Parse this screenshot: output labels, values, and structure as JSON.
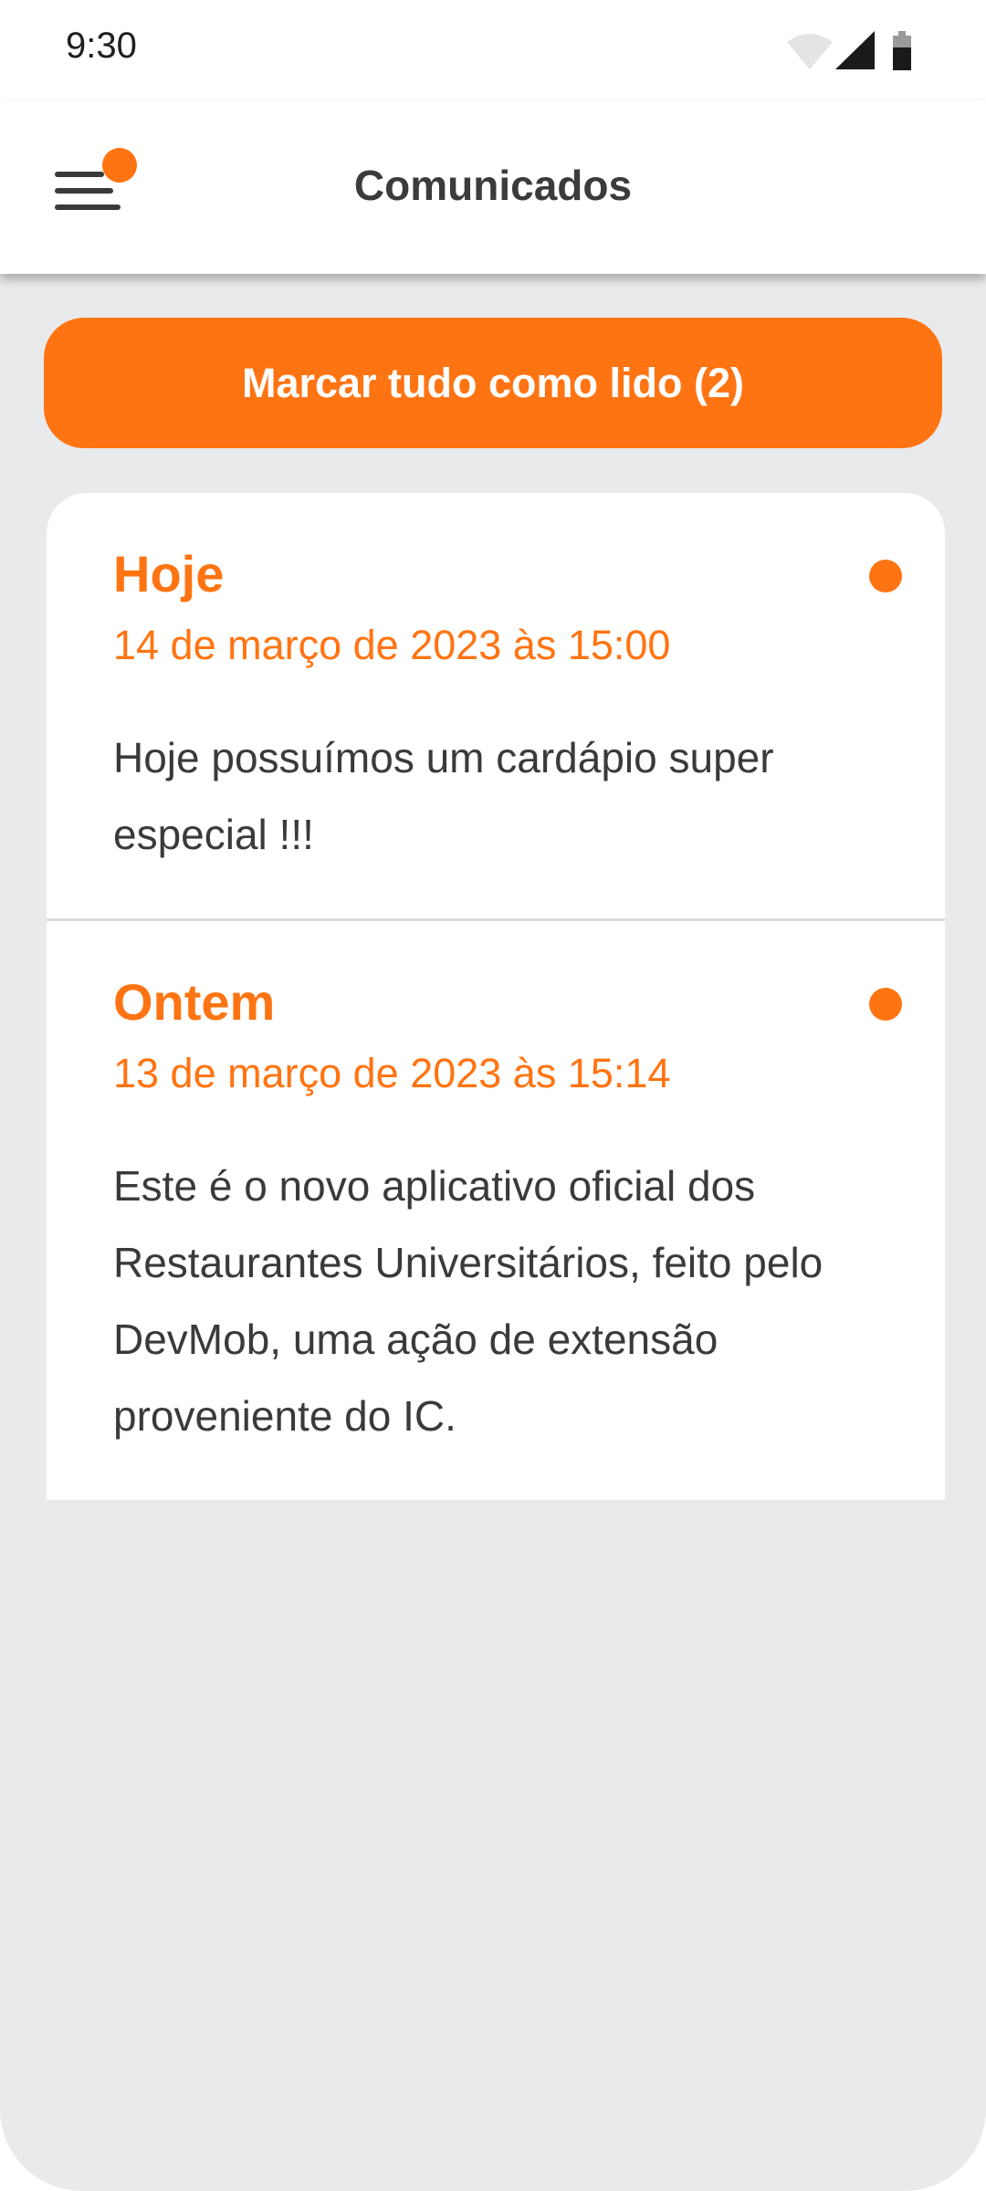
{
  "status_bar": {
    "time": "9:30",
    "icons": [
      "wifi-icon",
      "cellular-signal-icon",
      "battery-icon"
    ]
  },
  "app_bar": {
    "title": "Comunicados",
    "menu_icon": "menu-icon",
    "has_notification_badge": true
  },
  "actions": {
    "mark_all_label": "Marcar tudo como lido (2)"
  },
  "notices": [
    {
      "title": "Hoje",
      "date": "14 de março de 2023 às 15:00",
      "body": "Hoje possuímos um cardápio super especial !!!",
      "unread": true
    },
    {
      "title": "Ontem",
      "date": "13 de março de 2023 às 15:14",
      "body": "Este é o novo aplicativo oficial dos Restaurantes Universitários, feito pelo DevMob, uma ação de extensão proveniente do IC.",
      "unread": true
    }
  ],
  "colors": {
    "accent": "#ff7412",
    "background": "#e9eaec",
    "surface": "#ffffff",
    "text": "#3a3a3a"
  }
}
